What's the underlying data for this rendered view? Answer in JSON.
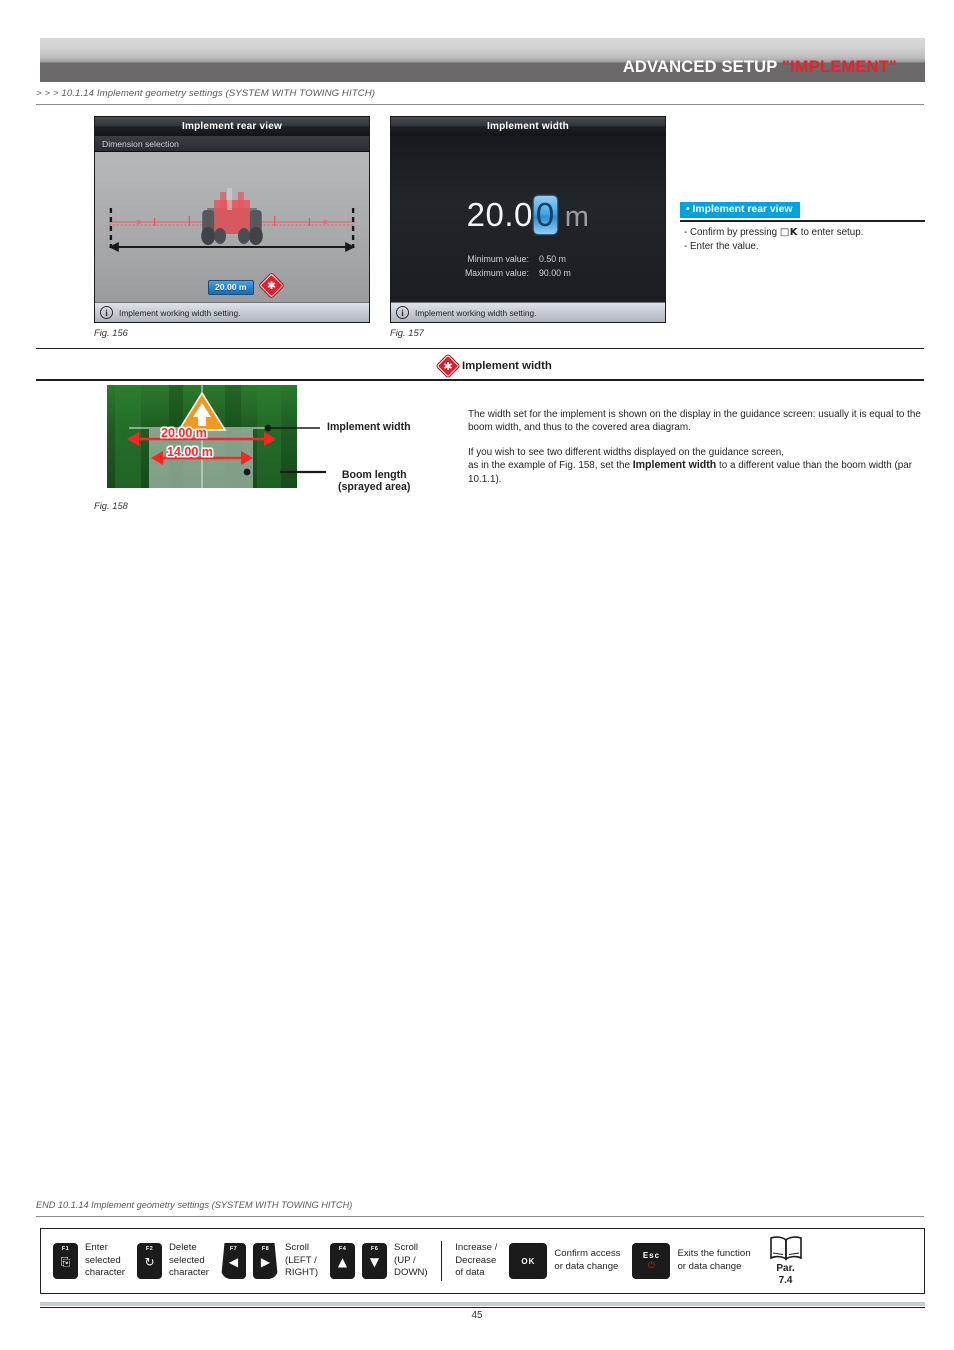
{
  "header": {
    "title_main": "ADVANCED SETUP ",
    "title_highlight": "\"IMPLEMENT\"",
    "highlight_color": "#e8212c"
  },
  "breadcrumb": "> > > 10.1.14 Implement geometry settings (SYSTEM WITH TOWING HITCH)",
  "fig156": {
    "caption": "Fig. 156",
    "title": "Implement rear view",
    "subtitle": "Dimension selection",
    "dimension_value": "20.00 m",
    "status_text": "Implement working width setting.",
    "info_icon": "info-icon"
  },
  "fig157": {
    "caption": "Fig. 157",
    "title": "Implement width",
    "value_prefix": "20.0",
    "value_cursor": "0",
    "unit": "m",
    "minimum_label": "Minimum value:",
    "minimum_value": "0.50 m",
    "maximum_label": "Maximum value:",
    "maximum_value": "90.00 m",
    "status_text": "Implement working width setting.",
    "info_icon": "info-icon"
  },
  "instruction": {
    "tag": "• Implement rear view",
    "tag_color": "#00a3e0",
    "line1_pre": "- Confirm by pressing ",
    "line1_key": "OK",
    "line1_post": " to enter setup.",
    "line2": "- Enter the value."
  },
  "section": {
    "icon": "red-diamond-asterisk-icon",
    "heading": "Implement width"
  },
  "fig158": {
    "caption": "Fig. 158",
    "implement_width_label": "20.00 m",
    "boom_length_label": "14.00 m",
    "vehicle_marker": "orange-triangle-vehicle-icon",
    "callout_1": "Implement width",
    "callout_2_line1": "Boom length",
    "callout_2_line2": "(sprayed area)"
  },
  "body": {
    "p1": "The width set for the implement is shown on the display in the guidance screen: usually it is equal to the boom width, and thus to the covered area diagram.",
    "p2_pre": "If you wish to see two different widths displayed on the guidance screen,",
    "p2_mid": "as in the example of Fig. 158, set the ",
    "p2_bold": "Implement width",
    "p2_post": " to a different value than the boom width (par 10.1.1)."
  },
  "end_note": "END 10.1.14 Implement geometry settings (SYSTEM WITH TOWING HITCH)",
  "legend": {
    "items": [
      {
        "keys": [
          {
            "label": "F1",
            "icon": "text-cursor-icon"
          }
        ],
        "text_lines": [
          "Enter",
          "selected",
          "character"
        ]
      },
      {
        "keys": [
          {
            "label": "F2",
            "icon": "circular-arrow-icon"
          }
        ],
        "text_lines": [
          "Delete",
          "selected",
          "character"
        ]
      },
      {
        "keys": [
          {
            "label": "F7",
            "icon": "arrow-left-icon"
          },
          {
            "label": "F8",
            "icon": "arrow-right-icon"
          }
        ],
        "text_lines": [
          "Scroll",
          "(LEFT /",
          "RIGHT)"
        ]
      },
      {
        "keys": [
          {
            "label": "F4",
            "icon": "arrow-up-icon"
          },
          {
            "label": "F6",
            "icon": "arrow-down-icon"
          }
        ],
        "text_lines": [
          "Scroll",
          "(UP /",
          "DOWN)"
        ]
      },
      {
        "keys": [],
        "text_lines": [
          "Increase /",
          "Decrease",
          "of data"
        ]
      },
      {
        "keys": [
          {
            "label": "OK",
            "icon": "ok-key-icon"
          }
        ],
        "text_lines": [
          "Confirm access",
          "or data change"
        ]
      },
      {
        "keys": [
          {
            "label": "Esc",
            "icon": "power-icon"
          }
        ],
        "text_lines": [
          "Exits the function",
          "or data change"
        ]
      }
    ],
    "book_icon": "open-book-icon",
    "par_label": "Par.",
    "par_value": "7.4"
  },
  "page_number": "45"
}
